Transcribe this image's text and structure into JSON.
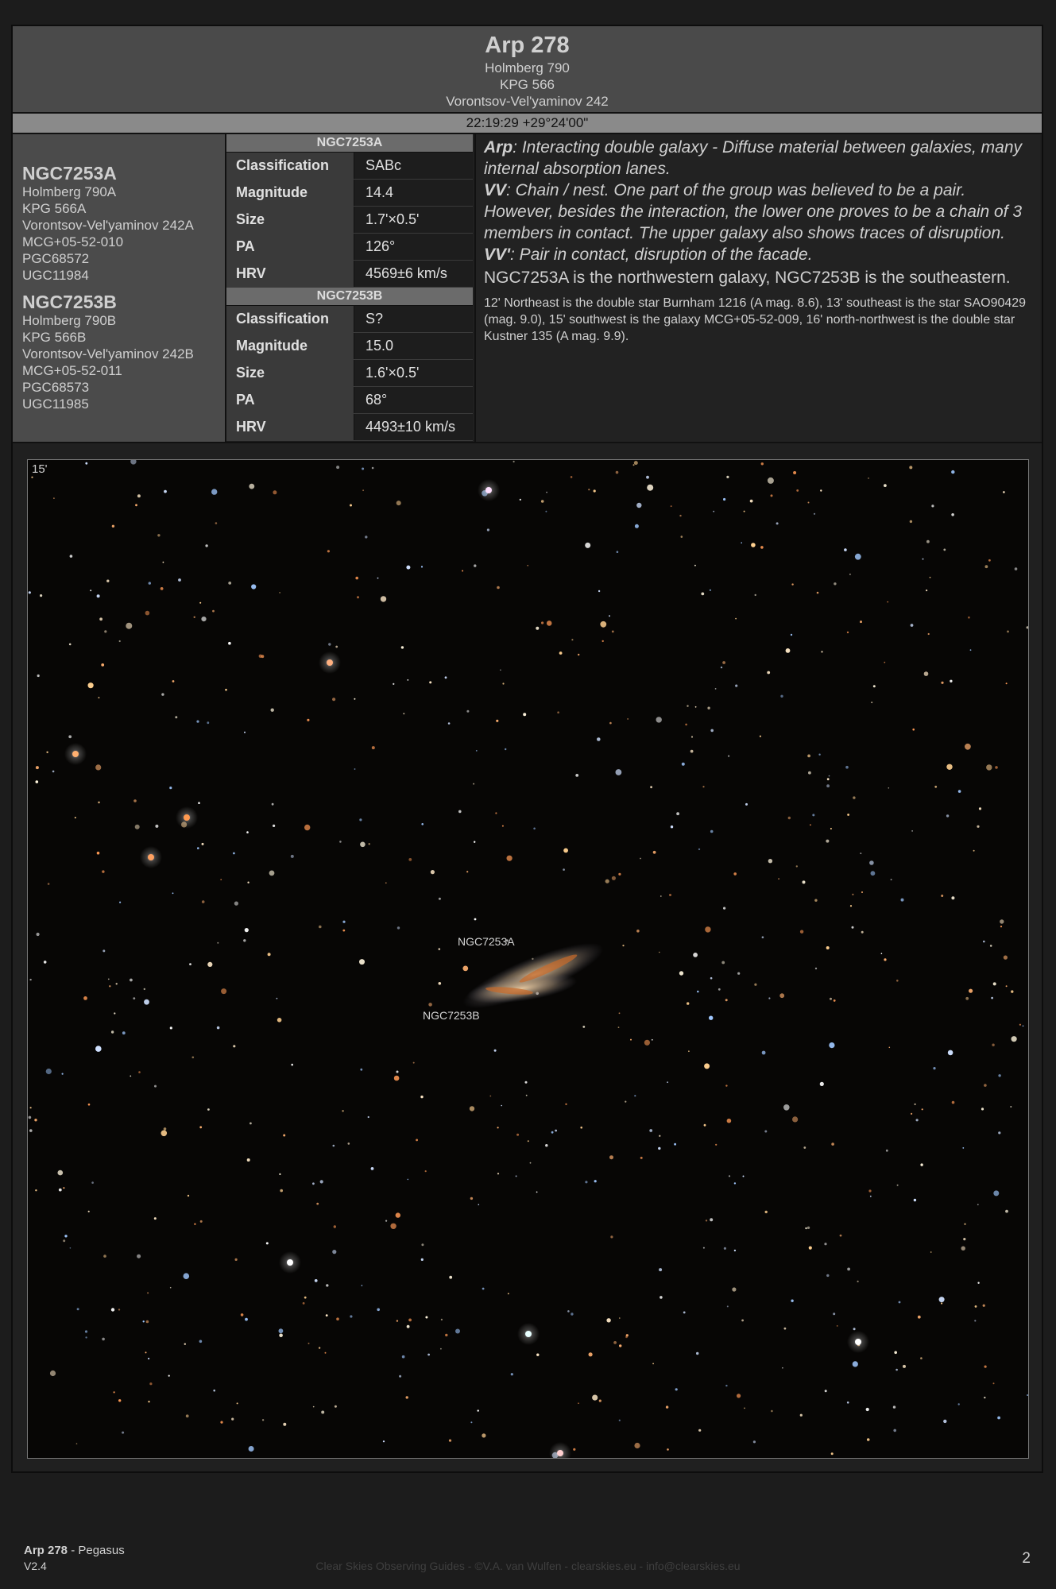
{
  "header": {
    "title": "Arp 278",
    "aliases": [
      "Holmberg 790",
      "KPG 566",
      "Vorontsov-Vel'yaminov 242"
    ],
    "coordinates": "22:19:29 +29°24'00\""
  },
  "galaxies": [
    {
      "name": "NGC7253A",
      "aliases": [
        "Holmberg 790A",
        "KPG 566A",
        "Vorontsov-Vel'yaminov 242A",
        "MCG+05-52-010",
        "PGC68572",
        "UGC11984"
      ],
      "table": {
        "header": "NGC7253A",
        "rows": [
          {
            "key": "Classification",
            "value": "SABc"
          },
          {
            "key": "Magnitude",
            "value": "14.4"
          },
          {
            "key": "Size",
            "value": "1.7'×0.5'"
          },
          {
            "key": "PA",
            "value": "126°"
          },
          {
            "key": "HRV",
            "value": "4569±6 km/s"
          }
        ]
      }
    },
    {
      "name": "NGC7253B",
      "aliases": [
        "Holmberg 790B",
        "KPG 566B",
        "Vorontsov-Vel'yaminov 242B",
        "MCG+05-52-011",
        "PGC68573",
        "UGC11985"
      ],
      "table": {
        "header": "NGC7253B",
        "rows": [
          {
            "key": "Classification",
            "value": "S?"
          },
          {
            "key": "Magnitude",
            "value": "15.0"
          },
          {
            "key": "Size",
            "value": "1.6'×0.5'"
          },
          {
            "key": "PA",
            "value": "68°"
          },
          {
            "key": "HRV",
            "value": "4493±10 km/s"
          }
        ]
      }
    }
  ],
  "description": {
    "arp_label": "Arp",
    "arp_text": ": Interacting double galaxy - Diffuse material between galaxies, many internal absorption lanes.",
    "vv_label": "VV",
    "vv_text": ": Chain / nest. One part of the group was believed to be a pair. However, besides the interaction, the lower one proves to be a chain of 3 members in contact. The upper galaxy also shows traces of disruption.",
    "vv2_label": "VV'",
    "vv2_text": ": Pair in contact, disruption of the facade.",
    "orientation": "NGC7253A is the northwestern galaxy, NGC7253B is the southeastern.",
    "surroundings": "12' Northeast is the double star Burnham 1216 (A mag. 8.6), 13' southeast is the star SAO90429 (mag. 9.0), 15' southwest is the galaxy MCG+05-52-009, 16' north-northwest is the double star Kustner 135 (A mag. 9.9)."
  },
  "image": {
    "scale_label": "15'",
    "label_a": "NGC7253A",
    "label_b": "NGC7253B"
  },
  "footer": {
    "object": "Arp 278",
    "constellation": " - Pegasus",
    "version": "V2.4",
    "credit": "Clear Skies Observing Guides - ©V.A. van Wulfen - clearskies.eu - info@clearskies.eu",
    "page": "2"
  }
}
